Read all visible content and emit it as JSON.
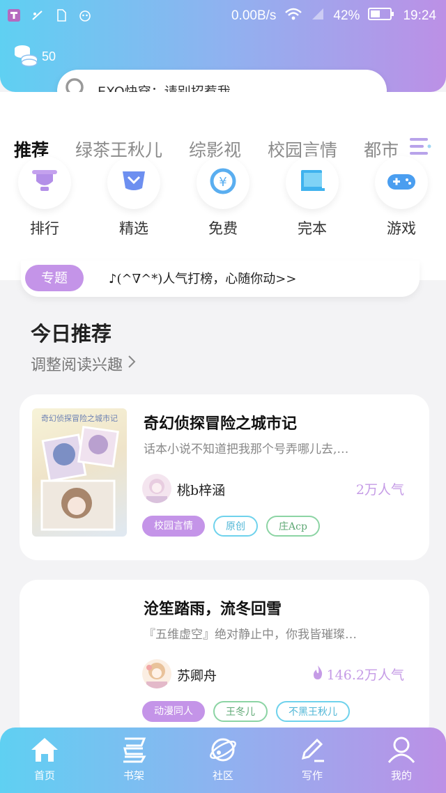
{
  "status_bar": {
    "network_speed": "0.00B/s",
    "battery": "42%",
    "time": "19:24"
  },
  "coins": {
    "count": "50"
  },
  "search": {
    "placeholder": "EXO快穿：请别招惹我"
  },
  "tabs": [
    "推荐",
    "绿茶王秋儿",
    "综影视",
    "校园言情",
    "都市"
  ],
  "quick_links": [
    {
      "label": "排行",
      "icon": "trophy-icon"
    },
    {
      "label": "精选",
      "icon": "selection-icon"
    },
    {
      "label": "免费",
      "icon": "yen-coin-icon"
    },
    {
      "label": "完本",
      "icon": "book-icon"
    },
    {
      "label": "游戏",
      "icon": "gamepad-icon"
    }
  ],
  "topic": {
    "badge": "专题",
    "text": "♪(^∇^*)人气打榜，心随你动>>"
  },
  "today": {
    "title": "今日推荐",
    "adjust_label": "调整阅读兴趣"
  },
  "books": [
    {
      "title": "奇幻侦探冒险之城市记",
      "cover_title": "奇幻侦探冒险之城市记",
      "description": "话本小说不知道把我那个号弄哪儿去,…",
      "author": "桃b梓涵",
      "popularity": "2万人气",
      "tags": [
        "校园言情",
        "原创",
        "庄Acp"
      ]
    },
    {
      "title": "沧笙踏雨，流冬回雪",
      "description": "『五维虚空』绝对静止中，你我皆璀璨…",
      "author": "苏卿舟",
      "popularity": "146.2万人气",
      "tags": [
        "动漫同人",
        "王冬儿",
        "不黑王秋儿"
      ]
    }
  ],
  "bottom_nav": [
    {
      "label": "首页",
      "icon": "home-icon"
    },
    {
      "label": "书架",
      "icon": "bookshelf-icon"
    },
    {
      "label": "社区",
      "icon": "planet-icon"
    },
    {
      "label": "写作",
      "icon": "pen-icon"
    },
    {
      "label": "我的",
      "icon": "user-icon"
    }
  ],
  "colors": {
    "accent_purple": "#c494e8",
    "gradient_start": "#5fd0f2",
    "gradient_end": "#bc90e6"
  }
}
